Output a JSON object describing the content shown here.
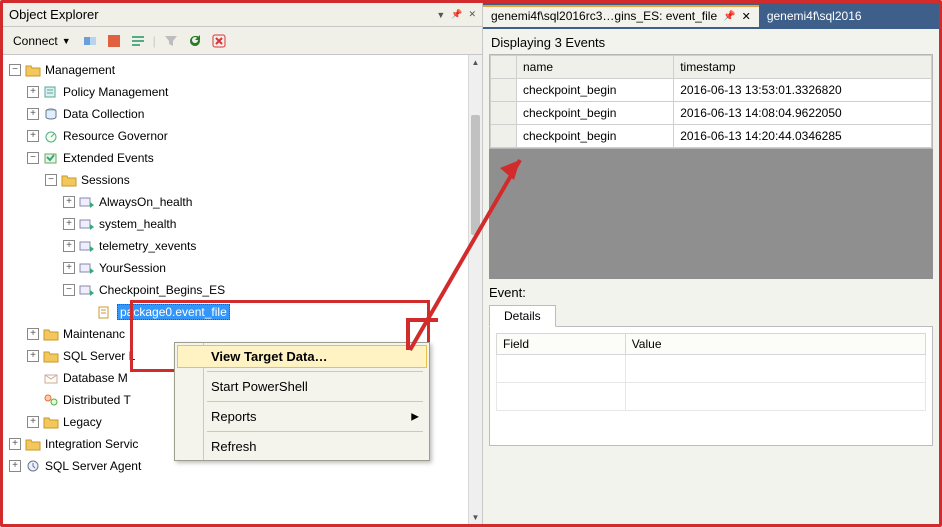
{
  "object_explorer": {
    "title": "Object Explorer",
    "connect_label": "Connect",
    "tree": {
      "management": "Management",
      "policy_management": "Policy Management",
      "data_collection": "Data Collection",
      "resource_governor": "Resource Governor",
      "extended_events": "Extended Events",
      "sessions": "Sessions",
      "always_on": "AlwaysOn_health",
      "system_health": "system_health",
      "telemetry": "telemetry_xevents",
      "your_session": "YourSession",
      "checkpoint_begins": "Checkpoint_Begins_ES",
      "package0": "package0.event_file",
      "maintenance": "Maintenanc",
      "sql_server_l": "SQL Server L",
      "database_m": "Database M",
      "distributed_t": "Distributed T",
      "legacy": "Legacy",
      "integration_services": "Integration Servic",
      "sql_server_agent": "SQL Server Agent"
    }
  },
  "context_menu": {
    "view_target_data": "View Target Data…",
    "start_powershell": "Start PowerShell",
    "reports": "Reports",
    "refresh": "Refresh"
  },
  "right": {
    "active_tab": "genemi4f\\sql2016rc3…gins_ES: event_file",
    "inactive_tab": "genemi4f\\sql2016",
    "displaying": "Displaying 3 Events",
    "columns": {
      "name": "name",
      "timestamp": "timestamp"
    },
    "rows": [
      {
        "name": "checkpoint_begin",
        "ts": "2016-06-13 13:53:01.3326820"
      },
      {
        "name": "checkpoint_begin",
        "ts": "2016-06-13 14:08:04.9622050"
      },
      {
        "name": "checkpoint_begin",
        "ts": "2016-06-13 14:20:44.0346285"
      }
    ],
    "event_label": "Event:",
    "details_tab": "Details",
    "field_col": "Field",
    "value_col": "Value"
  }
}
